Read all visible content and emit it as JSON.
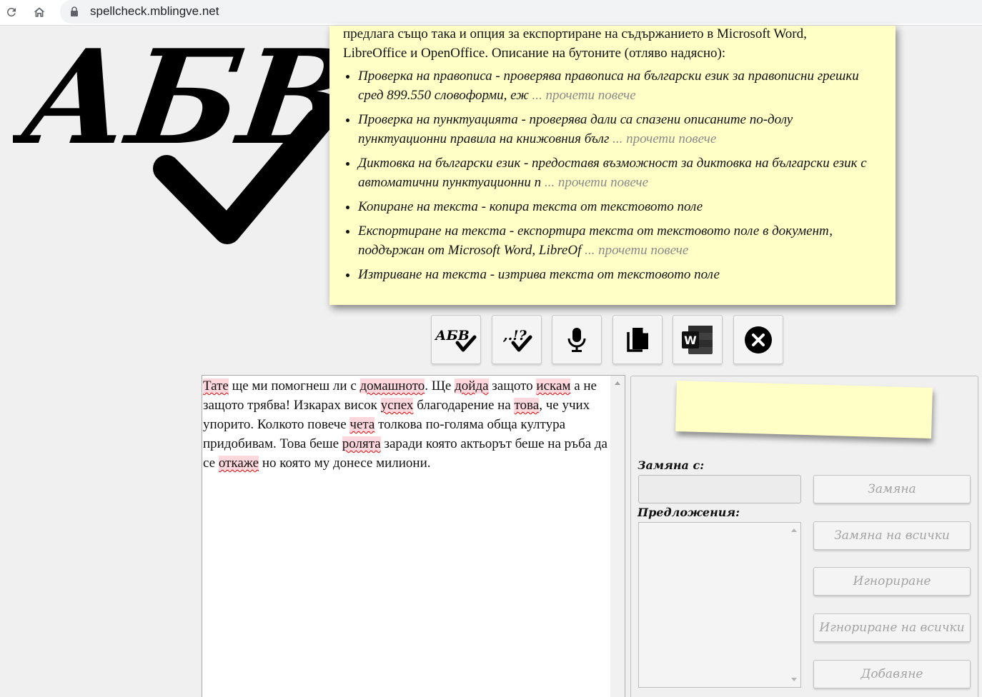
{
  "browser": {
    "url": "spellcheck.mblingve.net"
  },
  "logo": {
    "text": "АБВ"
  },
  "info": {
    "intro_line1": "предлага също така и опция за експортиране на съдържанието в Microsoft Word,",
    "intro_line2": "LibreOffice и OpenOffice. Описание на бутоните (отляво надясно):",
    "items": [
      {
        "text": "Проверка на правописа - проверява правописа на български език за правописни грешки сред 899.550 словоформи, еж",
        "more": "... прочети повече"
      },
      {
        "text": "Проверка на пунктуацията - проверява дали са спазени описаните по-долу пунктуационни правила на книжовния бълг",
        "more": "... прочети повече"
      },
      {
        "text": "Диктовка на български език - предоставя възможност за диктовка на български език с автоматични пунктуационни п",
        "more": "... прочети повече"
      },
      {
        "text": "Копиране на текста - копира текста от текстовото поле",
        "more": ""
      },
      {
        "text": "Експортиране на текста - експортира текста от текстовото поле в документ, поддържан от Microsoft Word, LibreOf",
        "more": "... прочети повече"
      },
      {
        "text": "Изтриване на текста - изтрива текста от текстовото поле",
        "more": ""
      }
    ]
  },
  "toolbar": {
    "spellcheck_icon_text": "АБВ",
    "punctuation_icon_text": ",.!?",
    "word_icon_letter": "W"
  },
  "editor": {
    "segments": [
      {
        "t": "Тате",
        "err": true
      },
      {
        "t": " ще ми помогнеш ли с ",
        "err": false
      },
      {
        "t": "домашното",
        "err": true
      },
      {
        "t": ". Ще ",
        "err": false
      },
      {
        "t": "дойда",
        "err": true
      },
      {
        "t": " защото ",
        "err": false
      },
      {
        "t": "искам",
        "err": true
      },
      {
        "t": " а не защото трябва! Изкарах висок ",
        "err": false
      },
      {
        "t": "успех",
        "err": true
      },
      {
        "t": " благодарение на ",
        "err": false
      },
      {
        "t": "това",
        "err": true
      },
      {
        "t": ", че учих упорито. Колкото повече ",
        "err": false
      },
      {
        "t": "чета",
        "err": true
      },
      {
        "t": " толкова по-голяма обща култура придобивам. Това беше ",
        "err": false
      },
      {
        "t": "ролята",
        "err": true
      },
      {
        "t": " заради която актьорът беше на ръба да се ",
        "err": false
      },
      {
        "t": "откаже",
        "err": true
      },
      {
        "t": " но която му донесе милиони.",
        "err": false
      }
    ]
  },
  "side": {
    "replace_label": "Замяна с:",
    "replace_value": "",
    "suggestions_label": "Предложения:",
    "buttons": {
      "replace": "Замяна",
      "replace_all": "Замяна на всички",
      "ignore": "Игнориране",
      "ignore_all": "Игнориране на всички",
      "add": "Добавяне"
    }
  }
}
